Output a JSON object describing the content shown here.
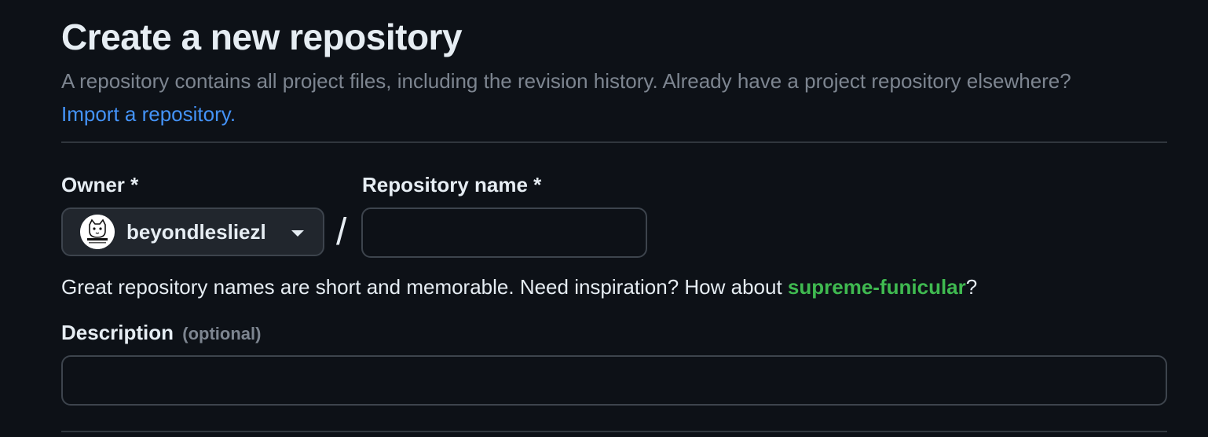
{
  "page": {
    "title": "Create a new repository",
    "lead_text": "A repository contains all project files, including the revision history. Already have a project repository elsewhere?",
    "import_link": "Import a repository."
  },
  "owner": {
    "label": "Owner *",
    "selected": "beyondlesliezl",
    "avatar_icon": "cat-avatar-icon"
  },
  "separator": "/",
  "repository": {
    "label": "Repository name *",
    "value": "",
    "placeholder": ""
  },
  "hint": {
    "prefix": "Great repository names are short and memorable. Need inspiration? How about ",
    "suggestion": "supreme-funicular",
    "suffix": "?"
  },
  "description": {
    "label": "Description",
    "optional_label": "(optional)",
    "value": "",
    "placeholder": ""
  },
  "colors": {
    "background": "#0d1117",
    "text": "#e6edf3",
    "muted": "#7d8590",
    "link": "#4493f8",
    "suggestion": "#3fb950",
    "border": "#3d444d"
  }
}
